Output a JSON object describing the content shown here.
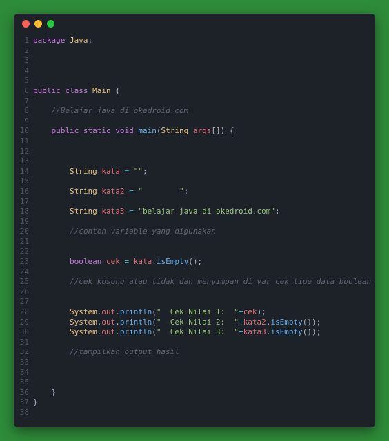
{
  "window_controls": {
    "close": "close",
    "minimize": "minimize",
    "zoom": "zoom"
  },
  "code": {
    "lines": [
      [
        [
          "keyword",
          "package"
        ],
        [
          "plain",
          " "
        ],
        [
          "class",
          "Java"
        ],
        [
          "punct",
          ";"
        ]
      ],
      [],
      [],
      [],
      [],
      [
        [
          "keyword",
          "public"
        ],
        [
          "plain",
          " "
        ],
        [
          "keyword",
          "class"
        ],
        [
          "plain",
          " "
        ],
        [
          "class",
          "Main"
        ],
        [
          "plain",
          " "
        ],
        [
          "punct",
          "{"
        ]
      ],
      [],
      [
        [
          "plain",
          "    "
        ],
        [
          "comment",
          "//Belajar java di okedroid.com"
        ]
      ],
      [],
      [
        [
          "plain",
          "    "
        ],
        [
          "keyword",
          "public"
        ],
        [
          "plain",
          " "
        ],
        [
          "keyword",
          "static"
        ],
        [
          "plain",
          " "
        ],
        [
          "type",
          "void"
        ],
        [
          "plain",
          " "
        ],
        [
          "method",
          "main"
        ],
        [
          "punct",
          "("
        ],
        [
          "class",
          "String"
        ],
        [
          "plain",
          " "
        ],
        [
          "ident",
          "args"
        ],
        [
          "punct",
          "[]) {"
        ]
      ],
      [],
      [],
      [],
      [
        [
          "plain",
          "        "
        ],
        [
          "class",
          "String"
        ],
        [
          "plain",
          " "
        ],
        [
          "ident",
          "kata"
        ],
        [
          "plain",
          " "
        ],
        [
          "operator",
          "="
        ],
        [
          "plain",
          " "
        ],
        [
          "string",
          "\"\""
        ],
        [
          "punct",
          ";"
        ]
      ],
      [],
      [
        [
          "plain",
          "        "
        ],
        [
          "class",
          "String"
        ],
        [
          "plain",
          " "
        ],
        [
          "ident",
          "kata2"
        ],
        [
          "plain",
          " "
        ],
        [
          "operator",
          "="
        ],
        [
          "plain",
          " "
        ],
        [
          "string",
          "\"        \""
        ],
        [
          "punct",
          ";"
        ]
      ],
      [],
      [
        [
          "plain",
          "        "
        ],
        [
          "class",
          "String"
        ],
        [
          "plain",
          " "
        ],
        [
          "ident",
          "kata3"
        ],
        [
          "plain",
          " "
        ],
        [
          "operator",
          "="
        ],
        [
          "plain",
          " "
        ],
        [
          "string",
          "\"belajar java di okedroid.com\""
        ],
        [
          "punct",
          ";"
        ]
      ],
      [],
      [
        [
          "plain",
          "        "
        ],
        [
          "comment",
          "//contoh variable yang digunakan"
        ]
      ],
      [],
      [],
      [
        [
          "plain",
          "        "
        ],
        [
          "type",
          "boolean"
        ],
        [
          "plain",
          " "
        ],
        [
          "ident",
          "cek"
        ],
        [
          "plain",
          " "
        ],
        [
          "operator",
          "="
        ],
        [
          "plain",
          " "
        ],
        [
          "ident",
          "kata"
        ],
        [
          "punct",
          "."
        ],
        [
          "method",
          "isEmpty"
        ],
        [
          "punct",
          "();"
        ]
      ],
      [],
      [
        [
          "plain",
          "        "
        ],
        [
          "comment",
          "//cek kosong atau tidak dan menyimpan di var cek tipe data boolean"
        ]
      ],
      [],
      [],
      [
        [
          "plain",
          "        "
        ],
        [
          "class",
          "System"
        ],
        [
          "punct",
          "."
        ],
        [
          "ident",
          "out"
        ],
        [
          "punct",
          "."
        ],
        [
          "method",
          "println"
        ],
        [
          "punct",
          "("
        ],
        [
          "string",
          "\"  Cek Nilai 1:  \""
        ],
        [
          "operator",
          "+"
        ],
        [
          "ident",
          "cek"
        ],
        [
          "punct",
          ");"
        ]
      ],
      [
        [
          "plain",
          "        "
        ],
        [
          "class",
          "System"
        ],
        [
          "punct",
          "."
        ],
        [
          "ident",
          "out"
        ],
        [
          "punct",
          "."
        ],
        [
          "method",
          "println"
        ],
        [
          "punct",
          "("
        ],
        [
          "string",
          "\"  Cek Nilai 2:  \""
        ],
        [
          "operator",
          "+"
        ],
        [
          "ident",
          "kata2"
        ],
        [
          "punct",
          "."
        ],
        [
          "method",
          "isEmpty"
        ],
        [
          "punct",
          "());"
        ]
      ],
      [
        [
          "plain",
          "        "
        ],
        [
          "class",
          "System"
        ],
        [
          "punct",
          "."
        ],
        [
          "ident",
          "out"
        ],
        [
          "punct",
          "."
        ],
        [
          "method",
          "println"
        ],
        [
          "punct",
          "("
        ],
        [
          "string",
          "\"  Cek Nilai 3:  \""
        ],
        [
          "operator",
          "+"
        ],
        [
          "ident",
          "kata3"
        ],
        [
          "punct",
          "."
        ],
        [
          "method",
          "isEmpty"
        ],
        [
          "punct",
          "());"
        ]
      ],
      [],
      [
        [
          "plain",
          "        "
        ],
        [
          "comment",
          "//tampilkan output hasil"
        ]
      ],
      [],
      [],
      [],
      [
        [
          "plain",
          "    "
        ],
        [
          "punct",
          "}"
        ]
      ],
      [
        [
          "punct",
          "}"
        ]
      ],
      []
    ]
  }
}
